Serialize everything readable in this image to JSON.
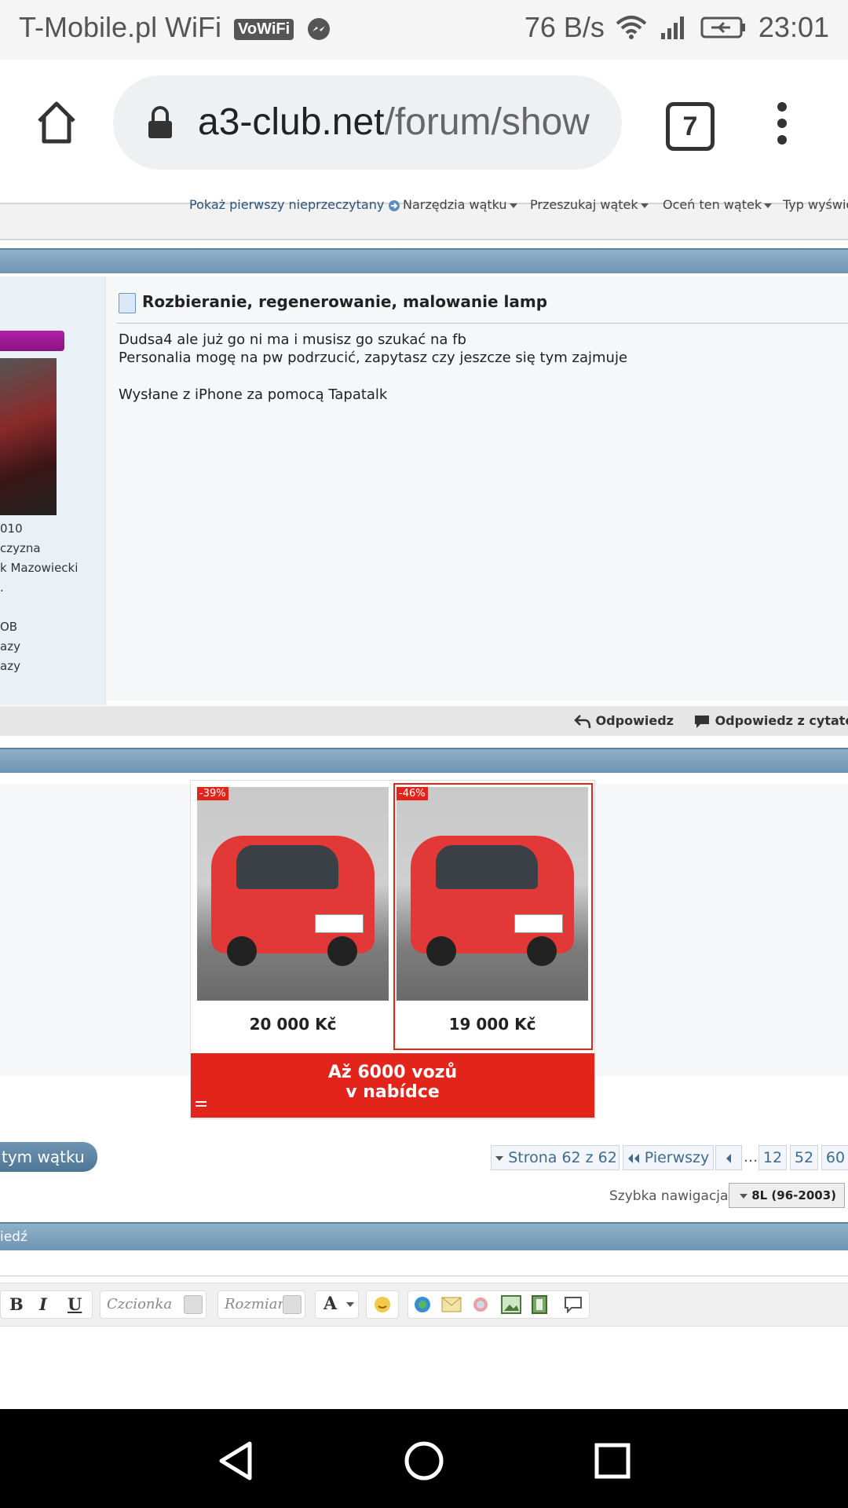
{
  "status_bar": {
    "carrier": "T-Mobile.pl WiFi",
    "vowifi_badge": "VoWiFi",
    "net_speed": "76 B/s",
    "time": "23:01"
  },
  "browser": {
    "url_domain": "a3-club.net",
    "url_path": "/forum/show",
    "tab_count": "7"
  },
  "thread_toolbar": {
    "first_unread": "Pokaż pierwszy nieprzeczytany",
    "thread_tools": "Narzędzia wątku",
    "search_thread": "Przeszukaj wątek",
    "rate_thread": "Oceń ten wątek",
    "display_mode": "Typ wyświe"
  },
  "post": {
    "title": "Rozbieranie, regenerowanie, malowanie lamp",
    "lines": [
      "Dudsa4 ale już go ni ma i musisz go szukać na fb",
      "Personalia mogę na pw podrzucić, zapytasz czy jeszcze się tym zajmuje",
      "Wysłane z iPhone za pomocą Tapatalk"
    ],
    "user_info": [
      "010",
      "czyzna",
      "k Mazowiecki",
      ".",
      "OB",
      "azy",
      "azy"
    ],
    "reply": "Odpowiedz",
    "reply_quote": "Odpowiedz z cytatem"
  },
  "ad": {
    "cars": [
      {
        "discount": "-39%",
        "price": "20 000 Kč"
      },
      {
        "discount": "-46%",
        "price": "19 000 Kč"
      }
    ],
    "cta_line1": "Až 6000 vozů",
    "cta_line2": "v nabídce"
  },
  "pagination": {
    "reply_button": "tym wątku",
    "page_of": "Strona 62 z 62",
    "first": "Pierwszy",
    "ellipsis": "...",
    "pages": [
      "12",
      "52",
      "60"
    ]
  },
  "quick_nav": {
    "label": "Szybka nawigacja",
    "value": "8L (96-2003)"
  },
  "quick_reply": {
    "header": "iedź",
    "font_placeholder": "Czcionka",
    "size_placeholder": "Rozmiar"
  }
}
